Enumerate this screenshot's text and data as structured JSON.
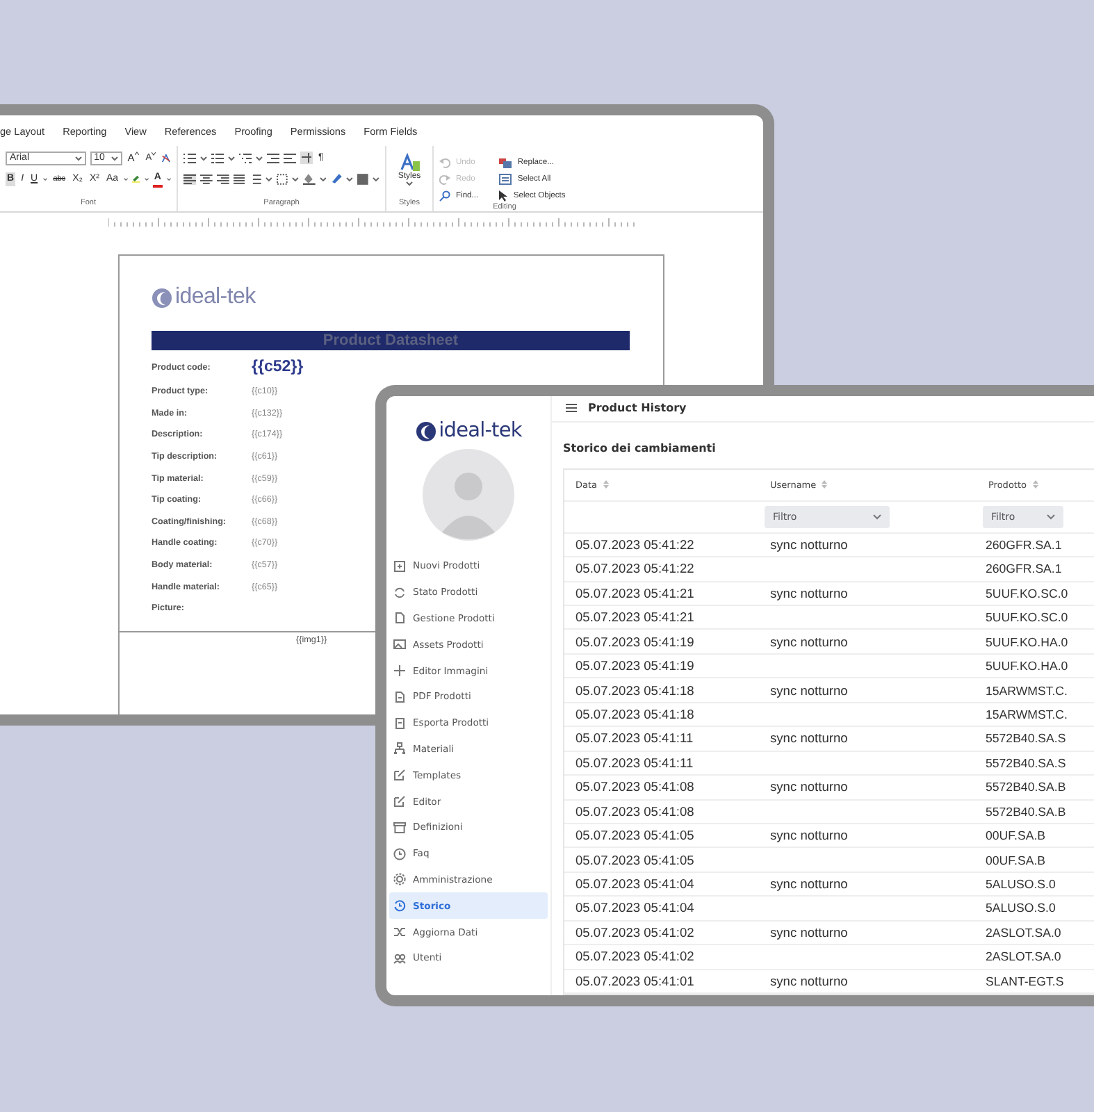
{
  "editor": {
    "tabs": [
      "ge Layout",
      "Reporting",
      "View",
      "References",
      "Proofing",
      "Permissions",
      "Form Fields"
    ],
    "font_name": "Arial",
    "font_size": "10",
    "size_buttons": [
      {
        "label": "A",
        "kind": "grow"
      },
      {
        "label": "A",
        "kind": "shrink"
      }
    ],
    "format_buttons": [
      {
        "label": "B",
        "kind": "bold"
      },
      {
        "label": "I",
        "kind": "italic"
      },
      {
        "label": "U",
        "kind": "underline"
      },
      {
        "label": "abc",
        "kind": "strike"
      },
      {
        "label": "X₂",
        "kind": "sub"
      },
      {
        "label": "X²",
        "kind": "sup"
      },
      {
        "label": "Aa",
        "kind": "case"
      },
      {
        "label": "A",
        "kind": "color"
      }
    ],
    "paragraph_mark": "¶",
    "groups": [
      "Font",
      "Paragraph",
      "Styles",
      "Editing"
    ],
    "styles_button": "Styles",
    "editing": [
      {
        "label": "Undo",
        "disabled": true
      },
      {
        "label": "Redo",
        "disabled": true
      },
      {
        "label": "Find...",
        "disabled": false
      },
      {
        "label": "Replace...",
        "disabled": false
      },
      {
        "label": "Select All",
        "disabled": false
      },
      {
        "label": "Select Objects",
        "disabled": false
      }
    ],
    "document": {
      "logo": "ideal-tek",
      "title": "Product Datasheet",
      "code_label": "Product code:",
      "code_value": "{{c52}}",
      "fields": [
        {
          "label": "Product type:",
          "value": "{{c10}}"
        },
        {
          "label": "Made in:",
          "value": "{{c132}}"
        },
        {
          "label": "Description:",
          "value": "{{c174}}"
        },
        {
          "label": "Tip description:",
          "value": "{{c61}}"
        },
        {
          "label": "Tip material:",
          "value": "{{c59}}"
        },
        {
          "label": "Tip coating:",
          "value": "{{c66}}"
        },
        {
          "label": "Coating/finishing:",
          "value": "{{c68}}"
        },
        {
          "label": "Handle coating:",
          "value": "{{c70}}"
        },
        {
          "label": "Body material:",
          "value": "{{c57}}"
        },
        {
          "label": "Handle material:",
          "value": "{{c65}}"
        },
        {
          "label": "Picture:"
        }
      ],
      "image_field": "{{img1}}"
    }
  },
  "app": {
    "logo": "ideal-tek",
    "nav": [
      {
        "label": "Nuovi Prodotti",
        "selected": false
      },
      {
        "label": "Stato Prodotti",
        "selected": false
      },
      {
        "label": "Gestione Prodotti",
        "selected": false
      },
      {
        "label": "Assets Prodotti",
        "selected": false
      },
      {
        "label": "Editor Immagini",
        "selected": false
      },
      {
        "label": "PDF Prodotti",
        "selected": false
      },
      {
        "label": "Esporta Prodotti",
        "selected": false
      },
      {
        "label": "Materiali",
        "selected": false
      },
      {
        "label": "Templates",
        "selected": false
      },
      {
        "label": "Editor",
        "selected": false
      },
      {
        "label": "Definizioni",
        "selected": false
      },
      {
        "label": "Faq",
        "selected": false
      },
      {
        "label": "Amministrazione",
        "selected": false
      },
      {
        "label": "Storico",
        "selected": true
      },
      {
        "label": "Aggiorna Dati",
        "selected": false
      },
      {
        "label": "Utenti",
        "selected": false
      }
    ],
    "header": "Product History",
    "section_title": "Storico dei cambiamenti",
    "columns": [
      {
        "label": "Data"
      },
      {
        "label": "Username",
        "filter": {
          "placeholder": "Filtro"
        }
      },
      {
        "label": "Prodotto",
        "filter": {
          "placeholder": "Filtro"
        }
      }
    ],
    "rows": [
      {
        "data": "05.07.2023 05:41:22",
        "username": "sync notturno",
        "prodotto": "260GFR.SA.1"
      },
      {
        "data": "05.07.2023 05:41:22",
        "prodotto": "260GFR.SA.1"
      },
      {
        "data": "05.07.2023 05:41:21",
        "username": "sync notturno",
        "prodotto": "5UUF.KO.SC.0"
      },
      {
        "data": "05.07.2023 05:41:21",
        "prodotto": "5UUF.KO.SC.0"
      },
      {
        "data": "05.07.2023 05:41:19",
        "username": "sync notturno",
        "prodotto": "5UUF.KO.HA.0"
      },
      {
        "data": "05.07.2023 05:41:19",
        "prodotto": "5UUF.KO.HA.0"
      },
      {
        "data": "05.07.2023 05:41:18",
        "username": "sync notturno",
        "prodotto": "15ARWMST.C."
      },
      {
        "data": "05.07.2023 05:41:18",
        "prodotto": "15ARWMST.C."
      },
      {
        "data": "05.07.2023 05:41:11",
        "username": "sync notturno",
        "prodotto": "5572B40.SA.S"
      },
      {
        "data": "05.07.2023 05:41:11",
        "prodotto": "5572B40.SA.S"
      },
      {
        "data": "05.07.2023 05:41:08",
        "username": "sync notturno",
        "prodotto": "5572B40.SA.B"
      },
      {
        "data": "05.07.2023 05:41:08",
        "prodotto": "5572B40.SA.B"
      },
      {
        "data": "05.07.2023 05:41:05",
        "username": "sync notturno",
        "prodotto": "00UF.SA.B"
      },
      {
        "data": "05.07.2023 05:41:05",
        "prodotto": "00UF.SA.B"
      },
      {
        "data": "05.07.2023 05:41:04",
        "username": "sync notturno",
        "prodotto": "5ALUSO.S.0"
      },
      {
        "data": "05.07.2023 05:41:04",
        "prodotto": "5ALUSO.S.0"
      },
      {
        "data": "05.07.2023 05:41:02",
        "username": "sync notturno",
        "prodotto": "2ASLOT.SA.0"
      },
      {
        "data": "05.07.2023 05:41:02",
        "prodotto": "2ASLOT.SA.0"
      },
      {
        "data": "05.07.2023 05:41:01",
        "username": "sync notturno",
        "prodotto": "SLANT-EGT.S"
      }
    ]
  }
}
